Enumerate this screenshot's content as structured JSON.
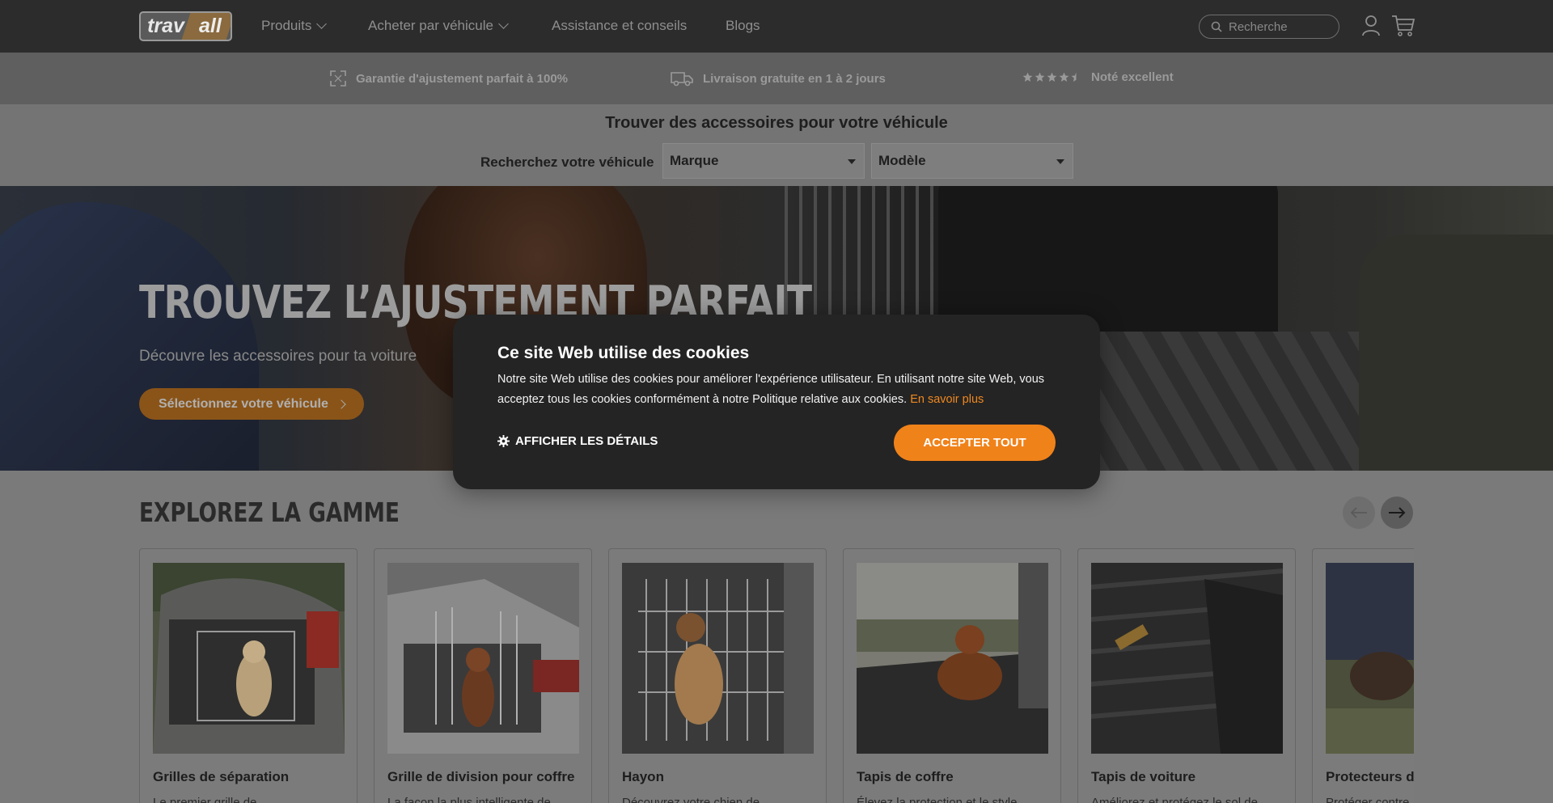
{
  "nav": {
    "logo_part1": "trav",
    "logo_part2": "all",
    "items": [
      "Produits",
      "Acheter par véhicule",
      "Assistance et conseils",
      "Blogs"
    ],
    "search_placeholder": "Recherche"
  },
  "benefits": [
    {
      "text": "Garantie d'ajustement parfait à 100%",
      "icon": "expand-icon"
    },
    {
      "text": "Livraison gratuite en 1 à 2 jours",
      "icon": "truck-icon"
    },
    {
      "text": "Noté excellent",
      "icon": "stars-icon",
      "rating": 4.5
    }
  ],
  "finder": {
    "title": "Trouver des accessoires pour votre véhicule",
    "label": "Recherchez votre véhicule",
    "brand_value": "Marque",
    "model_value": "Modèle"
  },
  "hero": {
    "title": "TROUVEZ L’AJUSTEMENT PARFAIT",
    "subtitle": "Découvre les accessoires pour ta voiture",
    "cta": "Sélectionnez votre véhicule"
  },
  "explore": {
    "title": "EXPLOREZ LA GAMME",
    "cards": [
      {
        "title": "Grilles de séparation",
        "desc": "Le premier grille de"
      },
      {
        "title": "Grille de division pour coffre",
        "desc": "La façon la plus intelligente de"
      },
      {
        "title": "Hayon",
        "desc": "Découvrez votre chien de"
      },
      {
        "title": "Tapis de coffre",
        "desc": "Élevez la protection et le style"
      },
      {
        "title": "Tapis de voiture",
        "desc": "Améliorez et protégez le sol de"
      },
      {
        "title": "Protecteurs de",
        "desc": "Protéger contre"
      }
    ]
  },
  "cookie": {
    "title": "Ce site Web utilise des cookies",
    "text": "Notre site Web utilise des cookies pour améliorer l'expérience utilisateur. En utilisant notre site Web, vous acceptez tous les cookies conformément à notre Politique relative aux cookies.",
    "link": "En savoir plus",
    "details_label": "AFFICHER LES DÉTAILS",
    "accept_label": "ACCEPTER TOUT"
  },
  "colors": {
    "accent": "#f0821a",
    "dark": "#242424"
  }
}
